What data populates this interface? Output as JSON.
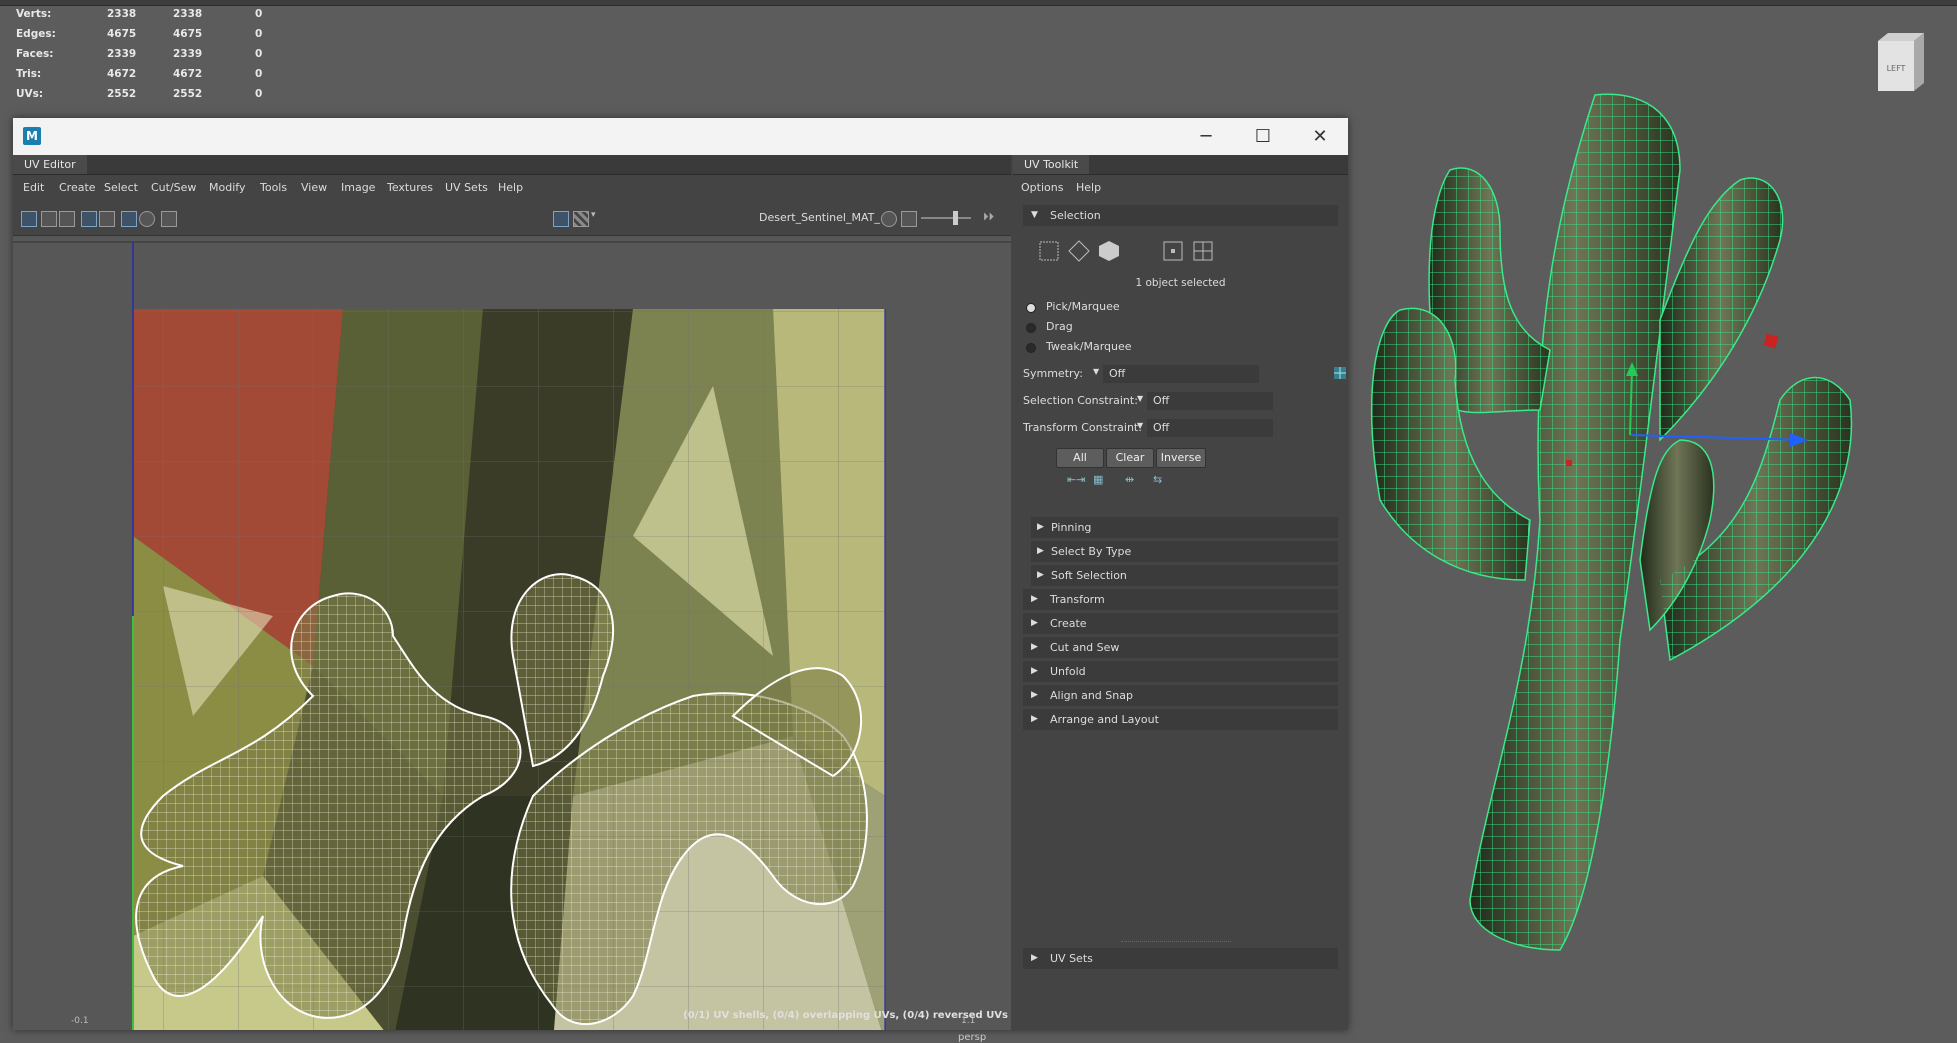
{
  "stats": [
    {
      "label": "Verts:",
      "a": "2338",
      "b": "2338",
      "c": "0"
    },
    {
      "label": "Edges:",
      "a": "4675",
      "b": "4675",
      "c": "0"
    },
    {
      "label": "Faces:",
      "a": "2339",
      "b": "2339",
      "c": "0"
    },
    {
      "label": "Tris:",
      "a": "4672",
      "b": "4672",
      "c": "0"
    },
    {
      "label": "UVs:",
      "a": "2552",
      "b": "2552",
      "c": "0"
    }
  ],
  "viewcube": {
    "label": "LEFT"
  },
  "viewport": {
    "camera": "persp"
  },
  "window": {
    "logo": "M",
    "minimize": "─",
    "maximize": "☐",
    "close": "✕"
  },
  "uv_editor": {
    "title": "UV Editor",
    "menus": [
      "Edit",
      "Create",
      "Select",
      "Cut/Sew",
      "Modify",
      "Tools",
      "View",
      "Image",
      "Textures",
      "UV Sets",
      "Help"
    ],
    "material": "Desert_Sentinel_MAT_",
    "status": "(0/1) UV shells, (0/4) overlapping UVs, (0/4) reversed UVs",
    "axis_left": "-0.1",
    "axis_right": "1.1"
  },
  "toolkit": {
    "title": "UV Toolkit",
    "menus": [
      "Options",
      "Help"
    ],
    "selection_header": "Selection",
    "selected_info": "1 object selected",
    "modes": [
      "Pick/Marquee",
      "Drag",
      "Tweak/Marquee"
    ],
    "symmetry": {
      "label": "Symmetry:",
      "value": "Off"
    },
    "selection_constraint": {
      "label": "Selection Constraint:",
      "value": "Off"
    },
    "transform_constraint": {
      "label": "Transform Constraint:",
      "value": "Off"
    },
    "buttons": [
      "All",
      "Clear",
      "Inverse"
    ],
    "subsections": [
      "Pinning",
      "Select By Type",
      "Soft Selection"
    ],
    "sections": [
      "Transform",
      "Create",
      "Cut and Sew",
      "Unfold",
      "Align and Snap",
      "Arrange and Layout"
    ],
    "footer": "UV Sets"
  },
  "colors": {
    "accent": "#5a9fd4",
    "wire": "#39e98a",
    "uvborder_left": "#3fbf3f",
    "uvborder_bottom": "#d63a3a"
  }
}
